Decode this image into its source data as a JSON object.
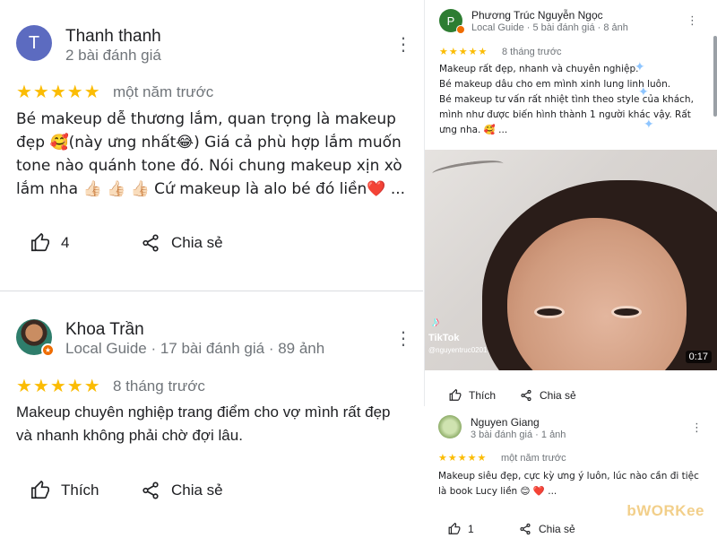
{
  "reviews_left": [
    {
      "avatar_letter": "T",
      "name": "Thanh thanh",
      "meta": "2 bài đánh giá",
      "stars": "★★★★★",
      "time": "một năm trước",
      "text": "Bé makeup dễ thương lắm, quan trọng là makeup đẹp 🥰(này ưng nhất😂) Giá cả phù hợp lắm muốn tone nào quánh tone đó. Nói chung makeup xịn xò lắm nha 👍🏻 👍🏻 👍🏻 Cứ makeup là alo bé đó liền❤️ ...",
      "like_count": "4",
      "share_label": "Chia sẻ",
      "more_icon": "⋮"
    },
    {
      "name": "Khoa Trần",
      "meta": "Local Guide · 17 bài đánh giá · 89 ảnh",
      "stars": "★★★★★",
      "time": "8 tháng trước",
      "text": "Makeup chuyên nghiệp trang điểm cho vợ mình rất đẹp và nhanh không phải chờ đợi lâu.",
      "like_label": "Thích",
      "share_label": "Chia sẻ",
      "more_icon": "⋮"
    }
  ],
  "review_right_top": {
    "avatar_letter": "P",
    "name": "Phương Trúc Nguyễn Ngọc",
    "meta": "Local Guide · 5 bài đánh giá · 8 ảnh",
    "stars": "★★★★★",
    "time": "8 tháng trước",
    "text_lines": [
      "Makeup rất đẹp, nhanh và chuyên nghiệp.",
      "Bé makeup dâu cho em mình xinh lung linh luôn.",
      "Bé makeup tư vấn rất nhiệt tình theo style của khách,",
      "mình như được biến hình thành 1 người khác vậy. Rất",
      "ưng nha. 🥰 ..."
    ],
    "video": {
      "platform": "TikTok",
      "username": "@nguyentruc0201",
      "duration": "0:17"
    },
    "like_label": "Thích",
    "share_label": "Chia sẻ",
    "more_icon": "⋮"
  },
  "review_right_bottom": {
    "name": "Nguyen Giang",
    "meta": "3 bài đánh giá · 1 ảnh",
    "stars": "★★★★★",
    "time": "một năm trước",
    "text_lines": [
      "Makeup siêu đẹp, cực kỳ ưng ý luôn, lúc nào cần đi tiệc",
      "là book Lucy liền 😊 ❤️ ..."
    ],
    "like_count": "1",
    "share_label": "Chia sẻ",
    "more_icon": "⋮"
  },
  "watermark": "bWORKee",
  "colors": {
    "star": "#fbbc04",
    "meta_text": "#70757a",
    "avatar_t": "#5c6bc0",
    "avatar_p": "#2e7d32",
    "local_guide_badge": "#ef6c00"
  }
}
